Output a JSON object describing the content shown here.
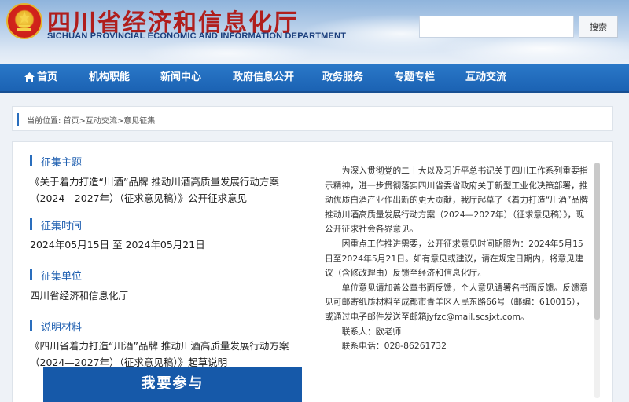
{
  "header": {
    "title": "四川省经济和信息化厅",
    "subtitle": "SICHUAN PROVINCIAL ECONOMIC AND INFORMATION DEPARTMENT",
    "search_placeholder": "",
    "search_button": "搜索"
  },
  "nav": {
    "items": [
      {
        "label": "首页",
        "icon": "home-icon"
      },
      {
        "label": "机构职能"
      },
      {
        "label": "新闻中心"
      },
      {
        "label": "政府信息公开"
      },
      {
        "label": "政务服务"
      },
      {
        "label": "专题专栏"
      },
      {
        "label": "互动交流"
      }
    ]
  },
  "breadcrumb": "当前位置: 首页>互动交流>意见征集",
  "sections": {
    "topic": {
      "heading": "征集主题",
      "body": "《关于着力打造“川酒”品牌 推动川酒高质量发展行动方案（2024—2027年）（征求意见稿）》公开征求意见"
    },
    "time": {
      "heading": "征集时间",
      "body": "2024年05月15日 至 2024年05月21日"
    },
    "unit": {
      "heading": "征集单位",
      "body": "四川省经济和信息化厅"
    },
    "material": {
      "heading": "说明材料",
      "body": "《四川省着力打造“川酒”品牌 推动川酒高质量发展行动方案（2024—2027年）（征求意见稿）》起草说明"
    }
  },
  "participate_button": "我要参与",
  "description": {
    "p1": "为深入贯彻党的二十大以及习近平总书记关于四川工作系列重要指示精神，进一步贯彻落实四川省委省政府关于新型工业化决策部署，推动优质白酒产业作出新的更大贡献，我厅起草了《着力打造“川酒”品牌推动川酒高质量发展行动方案（2024—2027年）（征求意见稿）》，现公开征求社会各界意见。",
    "p2": "因重点工作推进需要，公开征求意见时间期限为：2024年5月15日至2024年5月21日。如有意见或建议，请在规定日期内，将意见建议（含修改理由）反馈至经济和信息化厅。",
    "p3": "单位意见请加盖公章书面反馈，个人意见请署名书面反馈。反馈意见可邮寄纸质材料至成都市青羊区人民东路66号（邮编：610015），或通过电子邮件发送至邮箱jyfzc@mail.scsjxt.com。",
    "contact_person": "联系人：欧老师",
    "contact_phone": "联系电话：028-86261732"
  },
  "colors": {
    "title_red": "#b01e1c",
    "nav_blue": "#1b62b3",
    "accent_blue": "#2a6ebd",
    "button_blue": "#1659a9"
  }
}
